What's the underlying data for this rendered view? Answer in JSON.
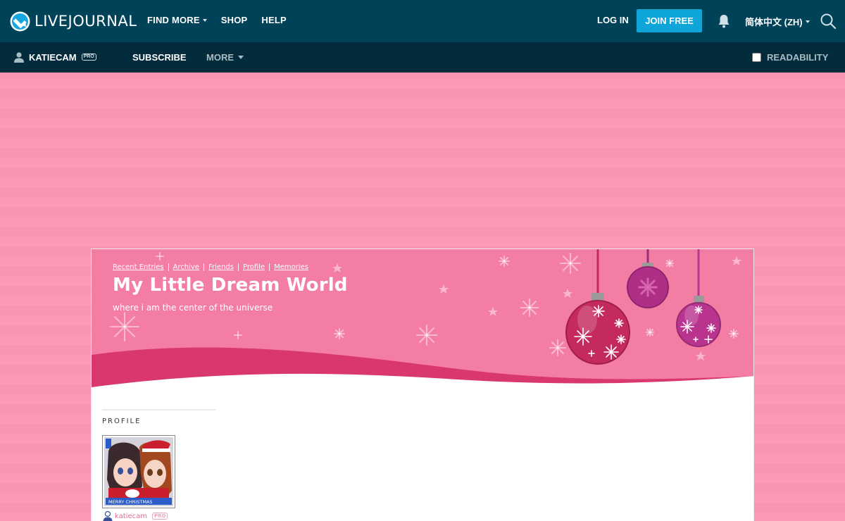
{
  "topbar": {
    "brand": "LIVEJOURNAL",
    "nav": [
      {
        "label": "FIND MORE",
        "has_caret": true
      },
      {
        "label": "SHOP",
        "has_caret": false
      },
      {
        "label": "HELP",
        "has_caret": false
      }
    ],
    "login_label": "LOG IN",
    "join_label": "JOIN FREE",
    "language_label": "简体中文 (ZH)",
    "icons": [
      "livejournal-logo-icon",
      "bell-icon",
      "search-icon"
    ]
  },
  "subbar": {
    "username": "KATIECAM",
    "pro_badge": "PRO",
    "subscribe_label": "SUBSCRIBE",
    "more_label": "MORE",
    "readability_label": "READABILITY",
    "readability_checked": false
  },
  "journal": {
    "nav": [
      "Recent Entries",
      "Archive",
      "Friends",
      "Profile",
      "Memories"
    ],
    "title": "My Little Dream World",
    "subtitle": "where i am the center of the universe",
    "profile_heading": "PROFILE",
    "userpic_caption": "MERRY CHRISTMAS",
    "username": "katiecam",
    "pro_badge": "PRO"
  },
  "colors": {
    "topbar": "#004359",
    "subbar": "#022b3c",
    "join_button": "#0ea5d8",
    "page_background": "#fc9ab6",
    "header_pink": "#f47ea3",
    "header_wave": "#d9386f",
    "ornament_red": "#c42a5c",
    "ornament_purple": "#b8348f"
  }
}
